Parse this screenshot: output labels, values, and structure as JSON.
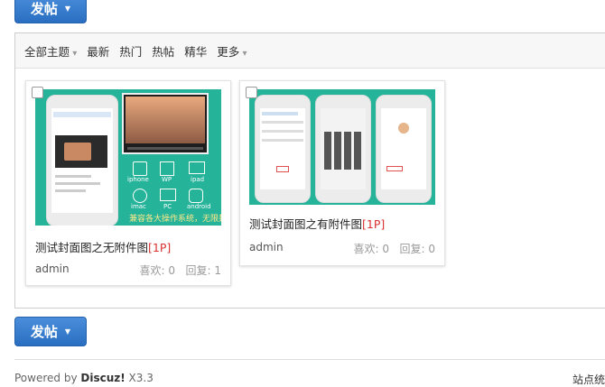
{
  "buttons": {
    "post_label": "发帖"
  },
  "filters": [
    {
      "label": "全部主题",
      "dropdown": true
    },
    {
      "label": "最新",
      "dropdown": false
    },
    {
      "label": "热门",
      "dropdown": false
    },
    {
      "label": "热帖",
      "dropdown": false
    },
    {
      "label": "精华",
      "dropdown": false
    },
    {
      "label": "更多",
      "dropdown": true
    }
  ],
  "cards": [
    {
      "title": "测试封面图之无附件图",
      "tag": "[1P]",
      "author": "admin",
      "likes_label": "喜欢: 0",
      "replies_label": "回复: 1",
      "image_caption": "兼容各大操作系统，无限封装",
      "platforms": [
        "iphone",
        "WP",
        "ipad",
        "imac",
        "PC",
        "android"
      ]
    },
    {
      "title": "测试封面图之有附件图",
      "tag": "[1P]",
      "author": "admin",
      "likes_label": "喜欢: 0",
      "replies_label": "回复: 0"
    }
  ],
  "footer": {
    "powered_prefix": "Powered by ",
    "brand": "Discuz!",
    "version": " X3.3",
    "site_stats": "站点统"
  },
  "colors": {
    "accent": "#2a6ec2",
    "thumb_bg": "#25b39a",
    "tag": "#d93131"
  }
}
